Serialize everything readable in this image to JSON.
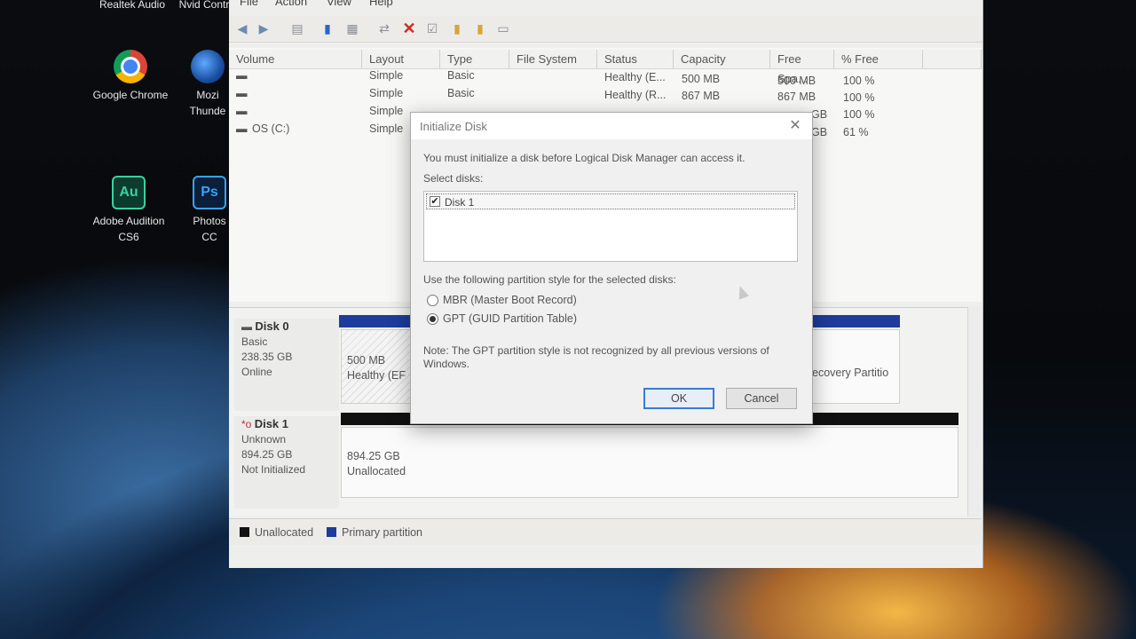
{
  "desktop": {
    "icons": [
      {
        "label": "Realtek Audio"
      },
      {
        "label": "Nvid Contr"
      },
      {
        "label": "Google Chrome"
      },
      {
        "label": "Mozi Thunde"
      },
      {
        "label": "Adobe Audition CS6"
      },
      {
        "label": "Photos CC"
      }
    ]
  },
  "app": {
    "menu": [
      "File",
      "Action",
      "View",
      "Help"
    ],
    "columns": [
      "Volume",
      "Layout",
      "Type",
      "File System",
      "Status",
      "Capacity",
      "Free Spa...",
      "% Free"
    ],
    "rows": [
      {
        "volume": "",
        "layout": "Simple",
        "type": "Basic",
        "fs": "",
        "status": "Healthy (E...",
        "capacity": "500 MB",
        "free": "500 MB",
        "pct": "100 %"
      },
      {
        "volume": "",
        "layout": "Simple",
        "type": "Basic",
        "fs": "",
        "status": "Healthy (R...",
        "capacity": "867 MB",
        "free": "867 MB",
        "pct": "100 %"
      },
      {
        "volume": "",
        "layout": "Simple",
        "type": "",
        "fs": "",
        "status": "",
        "capacity": "",
        "free": "GB",
        "pct": "100 %"
      },
      {
        "volume": "OS (C:)",
        "layout": "Simple",
        "type": "",
        "fs": "",
        "status": "",
        "capacity": "",
        "free": "GB",
        "pct": "61 %"
      }
    ],
    "disks": [
      {
        "name": "Disk 0",
        "type": "Basic",
        "size": "238.35 GB",
        "state": "Online",
        "part_size": "500 MB",
        "part_status": "Healthy (EF",
        "right_part": "ecovery Partitio"
      },
      {
        "name": "Disk 1",
        "type": "Unknown",
        "size": "894.25 GB",
        "state": "Not Initialized",
        "part_size": "894.25 GB",
        "part_status": "Unallocated"
      }
    ],
    "legend": [
      "Unallocated",
      "Primary partition"
    ],
    "colors": {
      "unallocated": "#111111",
      "primary": "#1d3c9c"
    }
  },
  "dialog": {
    "title": "Initialize Disk",
    "intro": "You must initialize a disk before Logical Disk Manager can access it.",
    "select_label": "Select disks:",
    "disk_item": "Disk 1",
    "disk_checked": true,
    "style_label": "Use the following partition style for the selected disks:",
    "options": [
      {
        "label": "MBR (Master Boot Record)",
        "selected": false
      },
      {
        "label": "GPT (GUID Partition Table)",
        "selected": true
      }
    ],
    "note": "Note: The GPT partition style is not recognized by all previous versions of Windows.",
    "ok": "OK",
    "cancel": "Cancel"
  }
}
